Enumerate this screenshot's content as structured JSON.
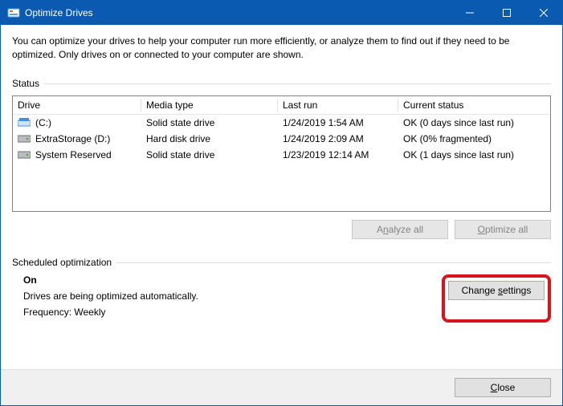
{
  "titlebar": {
    "title": "Optimize Drives"
  },
  "intro": "You can optimize your drives to help your computer run more efficiently, or analyze them to find out if they need to be optimized. Only drives on or connected to your computer are shown.",
  "status_label": "Status",
  "columns": {
    "drive": "Drive",
    "media": "Media type",
    "last": "Last run",
    "status": "Current status"
  },
  "drives": [
    {
      "name": " (C:)",
      "media": "Solid state drive",
      "last": "1/24/2019 1:54 AM",
      "status": "OK (0 days since last run)",
      "type": "ssd"
    },
    {
      "name": "ExtraStorage (D:)",
      "media": "Hard disk drive",
      "last": "1/24/2019 2:09 AM",
      "status": "OK (0% fragmented)",
      "type": "hdd"
    },
    {
      "name": "System Reserved",
      "media": "Solid state drive",
      "last": "1/23/2019 12:14 AM",
      "status": "OK (1 days since last run)",
      "type": "ssd"
    }
  ],
  "buttons": {
    "analyze_pre": "A",
    "analyze_u": "n",
    "analyze_post": "alyze all",
    "optimize_u": "O",
    "optimize_post": "ptimize all",
    "change_pre": "Change ",
    "change_u": "s",
    "change_post": "ettings",
    "close_u": "C",
    "close_post": "lose"
  },
  "sched": {
    "label": "Scheduled optimization",
    "on": "On",
    "auto": "Drives are being optimized automatically.",
    "freq": "Frequency: Weekly"
  }
}
